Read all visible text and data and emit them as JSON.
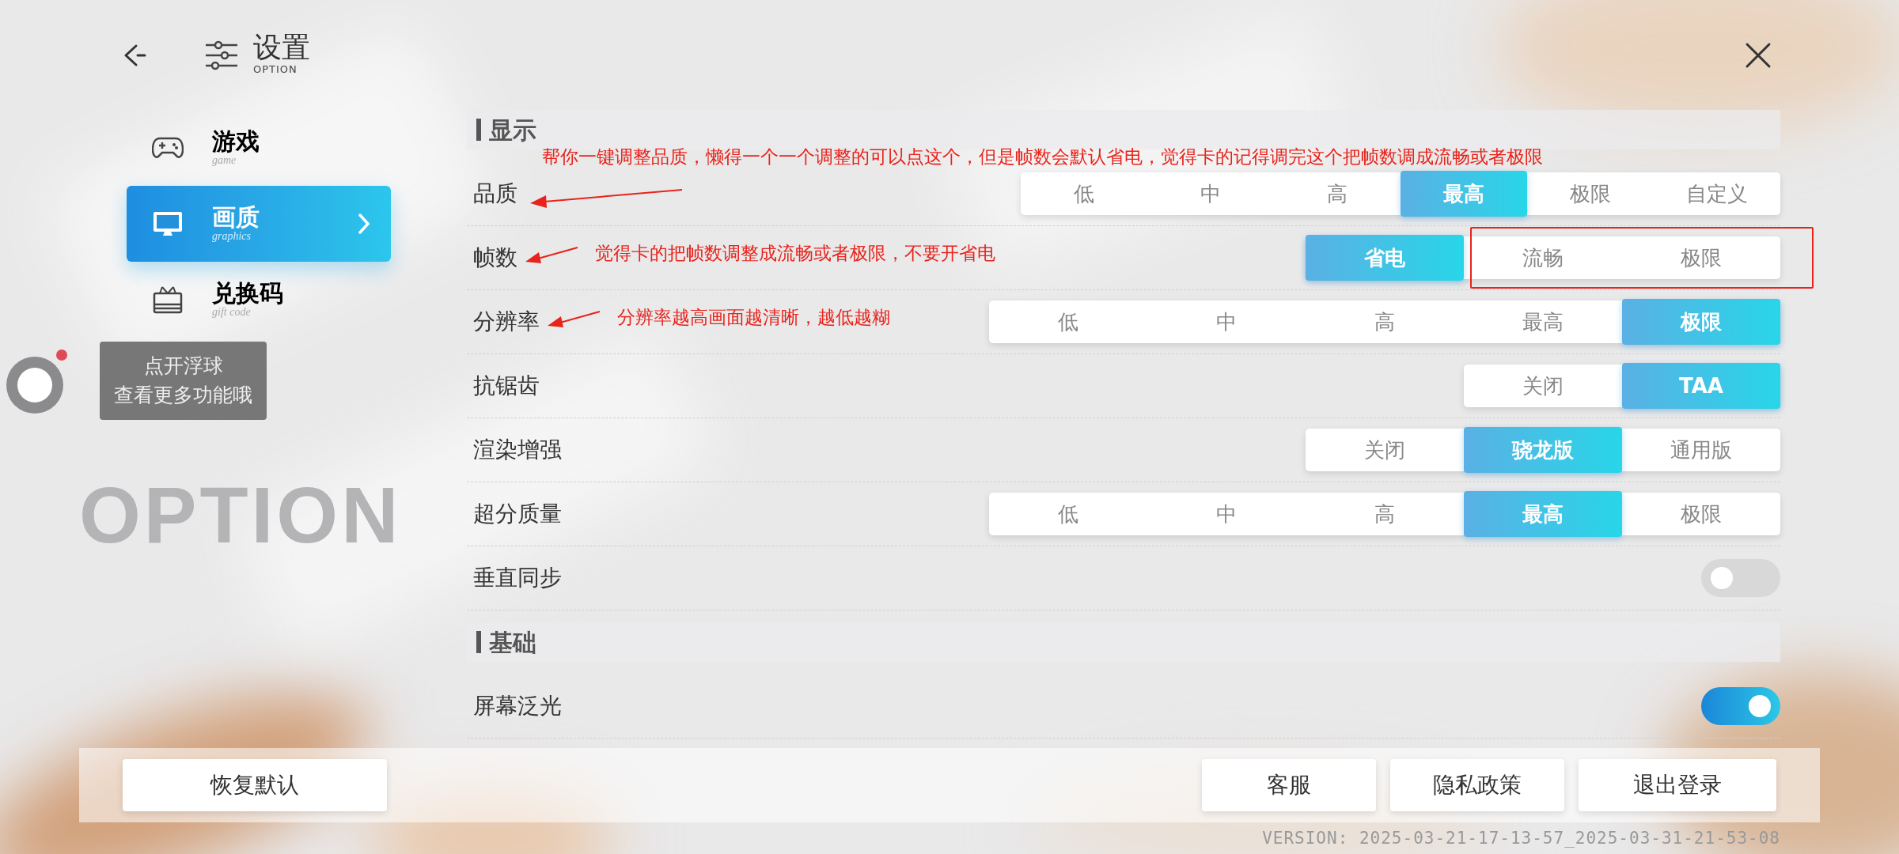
{
  "header": {
    "title": "设置",
    "subtitle": "OPTION"
  },
  "sidebar": [
    {
      "label": "游戏",
      "sublabel": "game",
      "selected": false
    },
    {
      "label": "画质",
      "sublabel": "graphics",
      "selected": true
    },
    {
      "label": "兑换码",
      "sublabel": "gift code",
      "selected": false
    }
  ],
  "float_ball": {
    "tooltip": [
      "点开浮球",
      "查看更多功能哦"
    ],
    "notification": true
  },
  "background_text": "OPTION",
  "sections": [
    {
      "title": "显示",
      "rows": [
        {
          "label": "品质",
          "kind": "segmented",
          "annotation": {
            "text": "帮你一键调整品质，懒得一个一个调整的可以点这个，但是帧数会默认省电，觉得卡的记得调完这个把帧数调成流畅或者极限",
            "kind": "above"
          },
          "options": [
            {
              "label": "低",
              "selected": false
            },
            {
              "label": "中",
              "selected": false
            },
            {
              "label": "高",
              "selected": false
            },
            {
              "label": "最高",
              "selected": true
            },
            {
              "label": "极限",
              "selected": false
            },
            {
              "label": "自定义",
              "selected": false
            }
          ]
        },
        {
          "label": "帧数",
          "kind": "segmented",
          "annotation": {
            "text": "觉得卡的把帧数调整成流畅或者极限，不要开省电",
            "kind": "beside"
          },
          "options": [
            {
              "label": "省电",
              "selected": true,
              "boxed": false
            },
            {
              "label": "流畅",
              "selected": false,
              "boxed": true
            },
            {
              "label": "极限",
              "selected": false,
              "boxed": true
            }
          ]
        },
        {
          "label": "分辨率",
          "kind": "segmented",
          "annotation": {
            "text": "分辨率越高画面越清晰，越低越糊",
            "kind": "beside"
          },
          "options": [
            {
              "label": "低",
              "selected": false
            },
            {
              "label": "中",
              "selected": false
            },
            {
              "label": "高",
              "selected": false
            },
            {
              "label": "最高",
              "selected": false
            },
            {
              "label": "极限",
              "selected": true
            }
          ]
        },
        {
          "label": "抗锯齿",
          "kind": "segmented",
          "options": [
            {
              "label": "关闭",
              "selected": false
            },
            {
              "label": "TAA",
              "selected": true
            }
          ]
        },
        {
          "label": "渲染增强",
          "kind": "segmented",
          "options": [
            {
              "label": "关闭",
              "selected": false
            },
            {
              "label": "骁龙版",
              "selected": true
            },
            {
              "label": "通用版",
              "selected": false
            }
          ]
        },
        {
          "label": "超分质量",
          "kind": "segmented",
          "options": [
            {
              "label": "低",
              "selected": false
            },
            {
              "label": "中",
              "selected": false
            },
            {
              "label": "高",
              "selected": false
            },
            {
              "label": "最高",
              "selected": true
            },
            {
              "label": "极限",
              "selected": false
            }
          ]
        },
        {
          "label": "垂直同步",
          "kind": "toggle",
          "on": false
        }
      ]
    },
    {
      "title": "基础",
      "rows": [
        {
          "label": "屏幕泛光",
          "kind": "toggle",
          "on": true
        }
      ]
    }
  ],
  "footer": {
    "left_buttons": [
      "恢复默认"
    ],
    "right_buttons": [
      "客服",
      "隐私政策",
      "退出登录"
    ],
    "version": "VERSION: 2025-03-21-17-13-57_2025-03-31-21-53-08"
  }
}
